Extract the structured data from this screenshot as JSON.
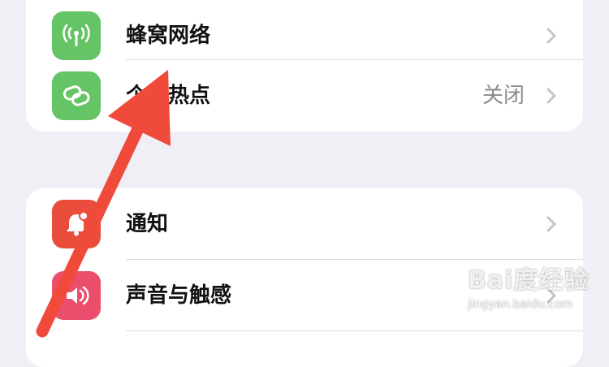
{
  "settings": {
    "group1": [
      {
        "label": "蜂窝网络",
        "value": "",
        "icon": "cellular-antenna-icon",
        "color": "#65c466"
      },
      {
        "label": "个人热点",
        "value": "关闭",
        "icon": "hotspot-link-icon",
        "color": "#65c466"
      }
    ],
    "group2": [
      {
        "label": "通知",
        "value": "",
        "icon": "notification-bell-icon",
        "color": "#eb4d3d"
      },
      {
        "label": "声音与触感",
        "value": "",
        "icon": "speaker-sound-icon",
        "color": "#ea4e6c"
      }
    ]
  },
  "annotation": {
    "color": "#ef4a3a"
  },
  "watermark": {
    "brand": "Bai度经验",
    "url": "jingyan.baidu.com"
  },
  "colors": {
    "background": "#f0eff5",
    "card": "#ffffff",
    "chevron": "#c4c4c7",
    "secondary_text": "#8a8a8e"
  }
}
